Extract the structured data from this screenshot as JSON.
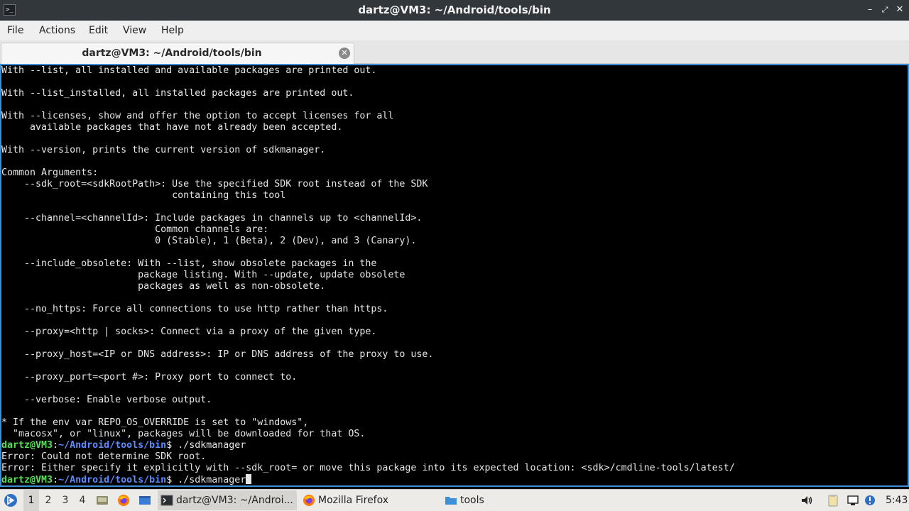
{
  "window": {
    "title": "dartz@VM3: ~/Android/tools/bin",
    "app_icon": ">_",
    "controls": [
      "minimize",
      "restore",
      "close"
    ]
  },
  "menu": [
    "File",
    "Actions",
    "Edit",
    "View",
    "Help"
  ],
  "tab": {
    "label": "dartz@VM3: ~/Android/tools/bin",
    "close_icon": "close-icon"
  },
  "terminal": {
    "lines": [
      "With --list, all installed and available packages are printed out.",
      "",
      "With --list_installed, all installed packages are printed out.",
      "",
      "With --licenses, show and offer the option to accept licenses for all",
      "     available packages that have not already been accepted.",
      "",
      "With --version, prints the current version of sdkmanager.",
      "",
      "Common Arguments:",
      "    --sdk_root=<sdkRootPath>: Use the specified SDK root instead of the SDK",
      "                              containing this tool",
      "",
      "    --channel=<channelId>: Include packages in channels up to <channelId>.",
      "                           Common channels are:",
      "                           0 (Stable), 1 (Beta), 2 (Dev), and 3 (Canary).",
      "",
      "    --include_obsolete: With --list, show obsolete packages in the",
      "                        package listing. With --update, update obsolete",
      "                        packages as well as non-obsolete.",
      "",
      "    --no_https: Force all connections to use http rather than https.",
      "",
      "    --proxy=<http | socks>: Connect via a proxy of the given type.",
      "",
      "    --proxy_host=<IP or DNS address>: IP or DNS address of the proxy to use.",
      "",
      "    --proxy_port=<port #>: Proxy port to connect to.",
      "",
      "    --verbose: Enable verbose output.",
      "",
      "* If the env var REPO_OS_OVERRIDE is set to \"windows\",",
      "  \"macosx\", or \"linux\", packages will be downloaded for that OS."
    ],
    "prompt_user": "dartz@VM3",
    "prompt_sep": ":",
    "prompt_path": "~/Android/tools/bin",
    "prompt_symbol": "$ ",
    "command1": "./sdkmanager",
    "error1": "Error: Could not determine SDK root.",
    "error2": "Error: Either specify it explicitly with --sdk_root= or move this package into its expected location: <sdk>/cmdline-tools/latest/",
    "command2": "./sdkmanager"
  },
  "taskbar": {
    "desktops": [
      "1",
      "2",
      "3",
      "4"
    ],
    "active_desktop": "1",
    "tasks": [
      {
        "label": "dartz@VM3: ~/Androi...",
        "icon": "terminal-icon"
      },
      {
        "label": "Mozilla Firefox",
        "icon": "firefox-icon"
      },
      {
        "label": "tools",
        "icon": "folder-icon"
      }
    ],
    "clock": "5:43"
  },
  "colors": {
    "titlebar": "#32373c",
    "terminal_bg": "#000000",
    "terminal_border": "#3d8fd6",
    "prompt_user": "#55e055",
    "prompt_path": "#5c8dff"
  }
}
